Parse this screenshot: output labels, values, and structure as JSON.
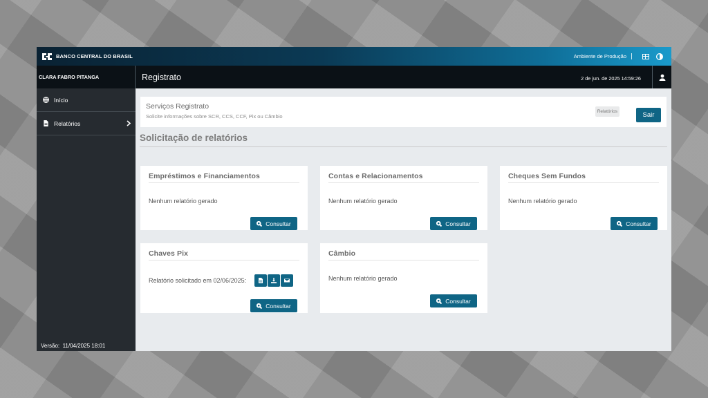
{
  "topbar": {
    "brand": "BANCO CENTRAL DO BRASIL",
    "environment": "Ambiente de Produção",
    "icons": [
      "table-icon",
      "contrast-icon"
    ]
  },
  "subbar": {
    "user_name": "CLARA FABRO PITANGA",
    "app_title": "Registrato",
    "datetime": "2 de jun. de 2025 14:59:26"
  },
  "sidebar": {
    "items": [
      {
        "label": "Início",
        "icon": "globe-icon"
      },
      {
        "label": "Relatórios",
        "icon": "document-icon"
      }
    ],
    "version": "Versão:  11/04/2025 18:01"
  },
  "header": {
    "title": "Serviços Registrato",
    "subtitle": "Solicite informações sobre SCR, CCS, CCF, Pix ou Câmbio",
    "badge": "Relatórios",
    "exit_label": "Sair"
  },
  "section_title": "Solicitação de relatórios",
  "consult_label": "Consultar",
  "cards": [
    {
      "title": "Empréstimos e Financiamentos",
      "status": "Nenhum relatório gerado"
    },
    {
      "title": "Contas e Relacionamentos",
      "status": "Nenhum relatório gerado"
    },
    {
      "title": "Cheques Sem Fundos",
      "status": "Nenhum relatório gerado"
    },
    {
      "title": "Chaves Pix",
      "status": "Relatório solicitado em 02/06/2025:"
    },
    {
      "title": "Câmbio",
      "status": "Nenhum relatório gerado"
    }
  ],
  "colors": {
    "primary": "#0f6585",
    "sidebar": "#262b30",
    "subbar": "#0b1116",
    "content_bg": "#e8ebee"
  }
}
